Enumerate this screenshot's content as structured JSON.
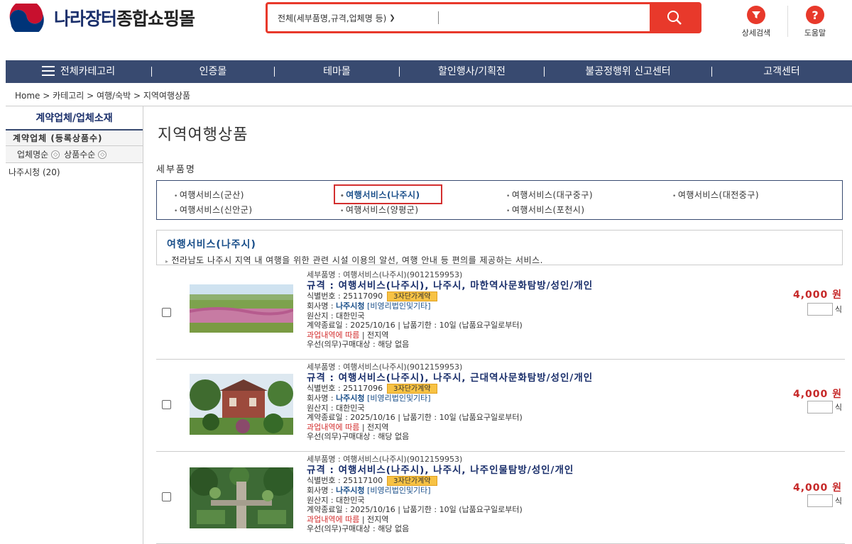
{
  "header": {
    "logo_main": "나라장터",
    "logo_sub": "종합쇼핑몰",
    "search_scope": "전체(세부품명,규격,업체명 등)",
    "search_value": "",
    "detail_search_label": "상세검색",
    "help_label": "도움말"
  },
  "nav": {
    "items": [
      {
        "label": "전체카테고리"
      },
      {
        "label": "인증몰"
      },
      {
        "label": "테마몰"
      },
      {
        "label": "할인행사/기획전"
      },
      {
        "label": "불공정행위 신고센터"
      },
      {
        "label": "고객센터"
      }
    ]
  },
  "breadcrumb": "Home > 카테고리 > 여행/숙박 > 지역여행상품",
  "sidebar": {
    "title": "계약업체/업체소재",
    "subtitle": "계약업체 (등록상품수)",
    "sort_name": "업체명순",
    "sort_count": "상품수순",
    "items": [
      {
        "label": "나주시청 (20)"
      }
    ]
  },
  "main": {
    "title": "지역여행상품",
    "detail_label": "세부품명",
    "categories": [
      {
        "label": "여행서비스(군산)",
        "selected": false
      },
      {
        "label": "여행서비스(나주시)",
        "selected": true
      },
      {
        "label": "여행서비스(대구중구)",
        "selected": false
      },
      {
        "label": "여행서비스(대전중구)",
        "selected": false
      },
      {
        "label": "여행서비스(신안군)",
        "selected": false
      },
      {
        "label": "여행서비스(양평군)",
        "selected": false
      },
      {
        "label": "여행서비스(포천시)",
        "selected": false
      }
    ],
    "info_title": "여행서비스(나주시)",
    "info_desc": "전라남도 나주시 지역 내 여행을 위한 관련 시설 이용의 알선, 여행 안내 등 편의를 제공하는 서비스."
  },
  "products": [
    {
      "kind": "세부품명 : 여행서비스(나주시)(9012159953)",
      "spec": "규격 : 여행서비스(나주시), 나주시, 마한역사문화탐방/성인/개인",
      "id_label": "식별번호 : 25117090",
      "badge": "3자단가계약",
      "company_label": "회사명 : ",
      "company": "나주시청",
      "company_type": "[비영리법인및기타]",
      "origin": "원산지 : 대한민국",
      "contract": "계약종료일 : 2025/10/16 | 납품기한 : 10일 (납품요구일로부터)",
      "warn": "과업내역에 따름",
      "warn_extra": " | 전지역",
      "priority": "우선(의무)구매대상 : 해당 없음",
      "price": "4,000 원",
      "unit": "식",
      "qty": ""
    },
    {
      "kind": "세부품명 : 여행서비스(나주시)(9012159953)",
      "spec": "규격 : 여행서비스(나주시), 나주시, 근대역사문화탐방/성인/개인",
      "id_label": "식별번호 : 25117096",
      "badge": "3자단가계약",
      "company_label": "회사명 : ",
      "company": "나주시청",
      "company_type": "[비영리법인및기타]",
      "origin": "원산지 : 대한민국",
      "contract": "계약종료일 : 2025/10/16 | 납품기한 : 10일 (납품요구일로부터)",
      "warn": "과업내역에 따름",
      "warn_extra": " | 전지역",
      "priority": "우선(의무)구매대상 : 해당 없음",
      "price": "4,000 원",
      "unit": "식",
      "qty": ""
    },
    {
      "kind": "세부품명 : 여행서비스(나주시)(9012159953)",
      "spec": "규격 : 여행서비스(나주시), 나주시, 나주인물탐방/성인/개인",
      "id_label": "식별번호 : 25117100",
      "badge": "3자단가계약",
      "company_label": "회사명 : ",
      "company": "나주시청",
      "company_type": "[비영리법인및기타]",
      "origin": "원산지 : 대한민국",
      "contract": "계약종료일 : 2025/10/16 | 납품기한 : 10일 (납품요구일로부터)",
      "warn": "과업내역에 따름",
      "warn_extra": " | 전지역",
      "priority": "우선(의무)구매대상 : 해당 없음",
      "price": "4,000 원",
      "unit": "식",
      "qty": ""
    }
  ]
}
